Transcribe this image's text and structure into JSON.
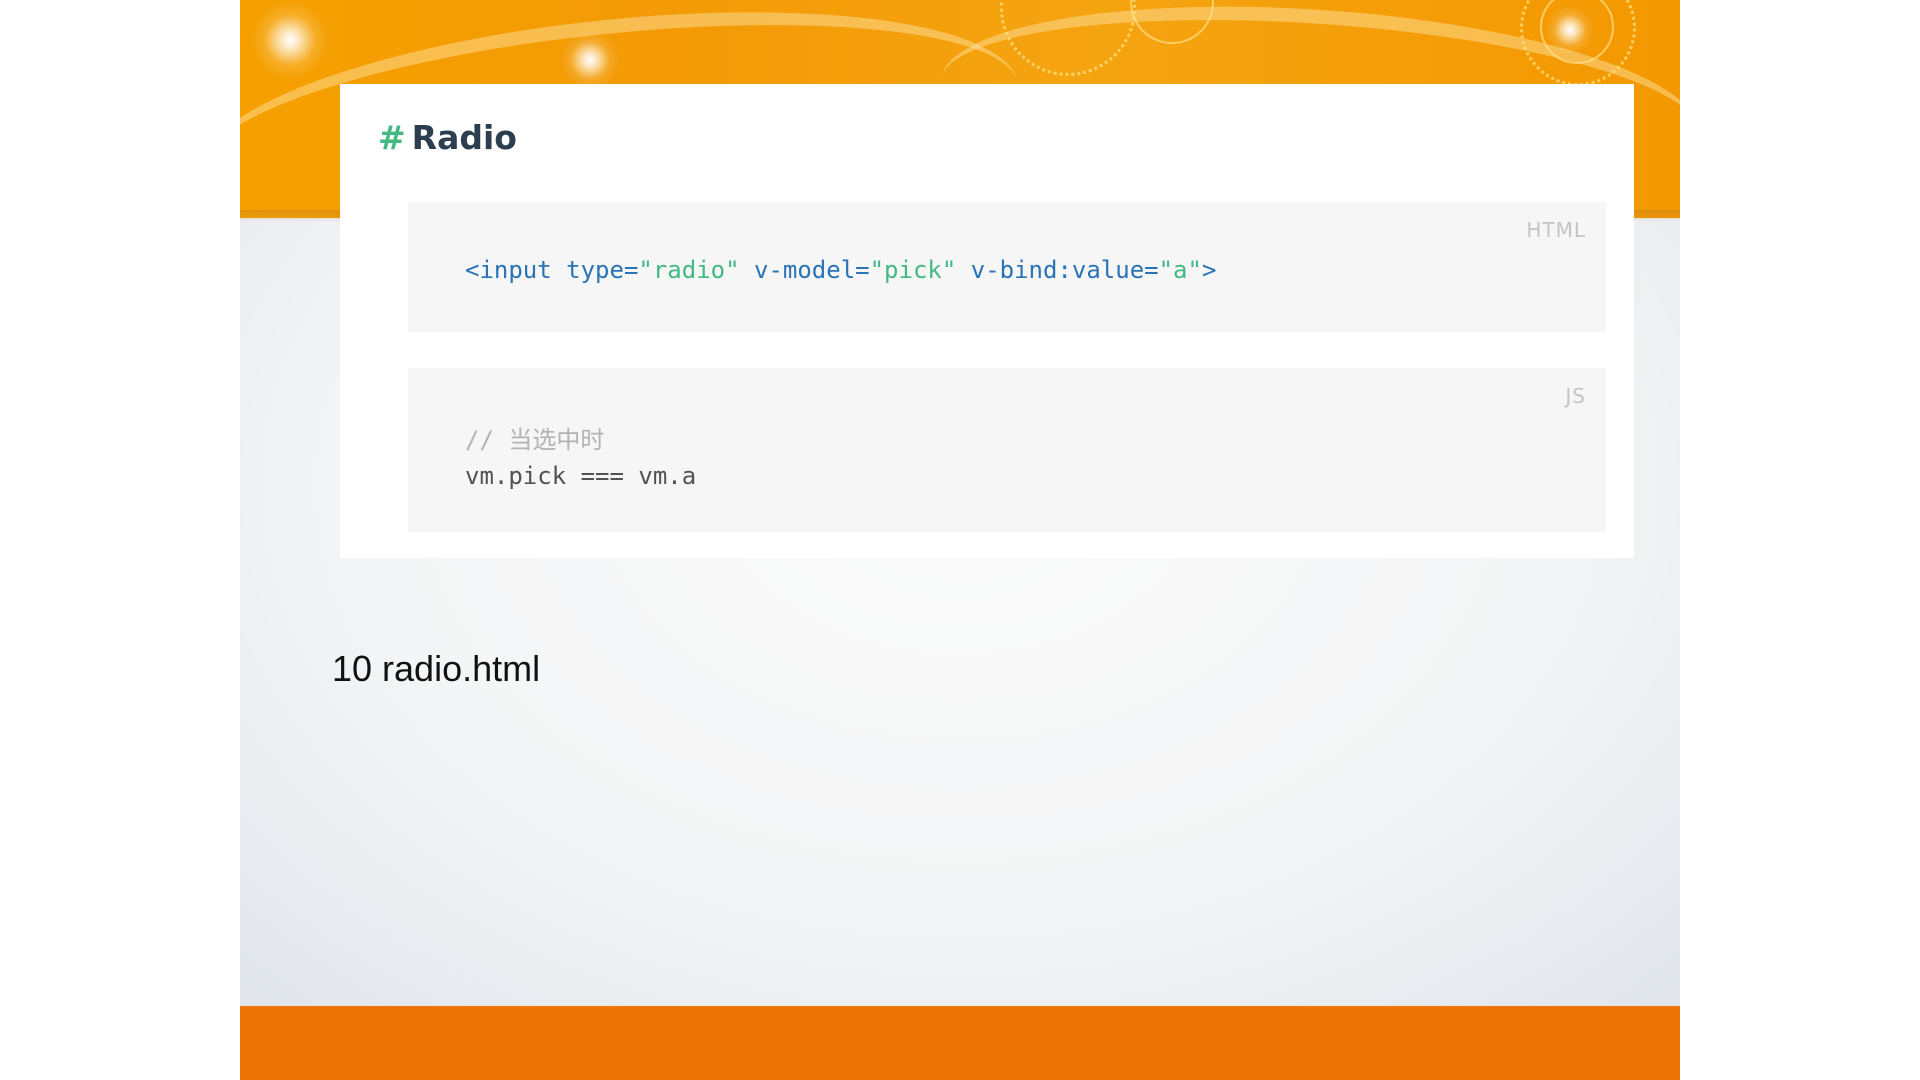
{
  "section": {
    "hash": "#",
    "title": "Radio"
  },
  "html_block": {
    "lang": "HTML",
    "tokens": {
      "t1": "<input type=",
      "s1": "\"radio\"",
      "t2": " v-model=",
      "s2": "\"pick\"",
      "t3": " v-bind:value=",
      "s3": "\"a\"",
      "t4": ">"
    }
  },
  "js_block": {
    "lang": "JS",
    "comment": "// 当选中时",
    "line2": "vm.pick === vm.a"
  },
  "caption": "10 radio.html",
  "colors": {
    "top_band": "#f5a000",
    "bottom_band": "#ec7506",
    "heading": "#2c3e50",
    "hash": "#42b983",
    "code_tag": "#2973b7",
    "code_string": "#42b983",
    "code_comment": "#b3b3b3",
    "code_bg": "#f6f6f6"
  }
}
